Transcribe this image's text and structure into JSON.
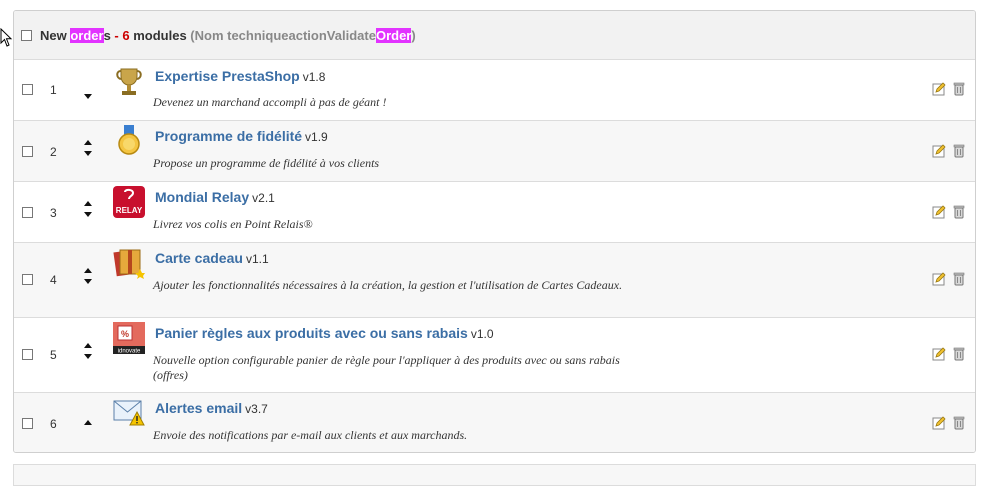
{
  "header": {
    "pre": "New ",
    "hl1": "order",
    "mid": "s",
    "dash": " - ",
    "count": "6",
    "modules": " modules ",
    "tech_open": "(Nom techniqueactionValidate",
    "hl2": "Order",
    "tech_close": ")"
  },
  "modules": [
    {
      "num": "1",
      "name": "Expertise PrestaShop",
      "version": "v1.8",
      "desc": "Devenez un marchand accompli à pas de géant !",
      "icon": "trophy-icon",
      "arrows": "down"
    },
    {
      "num": "2",
      "name": "Programme de fidélité",
      "version": "v1.9",
      "desc": "Propose un programme de fidélité à vos clients",
      "icon": "medal-icon",
      "arrows": "both"
    },
    {
      "num": "3",
      "name": "Mondial Relay",
      "version": "v2.1",
      "desc": "Livrez vos colis en Point Relais®",
      "icon": "mondial-relay-logo-icon",
      "logo_text": "RELAY",
      "arrows": "both"
    },
    {
      "num": "4",
      "name": "Carte cadeau",
      "version": "v1.1",
      "desc": "Ajouter les fonctionnalités nécessaires à la création, la gestion et l'utilisation de Cartes Cadeaux.",
      "icon": "gift-card-icon",
      "arrows": "both"
    },
    {
      "num": "5",
      "name": "Panier règles aux produits avec ou sans rabais",
      "version": "v1.0",
      "desc": "Nouvelle option configurable panier de règle pour l'appliquer à des produits avec ou sans rabais (offres)",
      "icon": "discount-rule-icon",
      "logo_text": "idnovate",
      "arrows": "both"
    },
    {
      "num": "6",
      "name": "Alertes email",
      "version": "v3.7",
      "desc": "Envoie des notifications par e-mail aux clients et aux marchands.",
      "icon": "email-alert-icon",
      "arrows": "up"
    }
  ],
  "colors": {
    "link": "#3b6ea5",
    "highlight": "#e233ff",
    "count": "#cc0000"
  }
}
